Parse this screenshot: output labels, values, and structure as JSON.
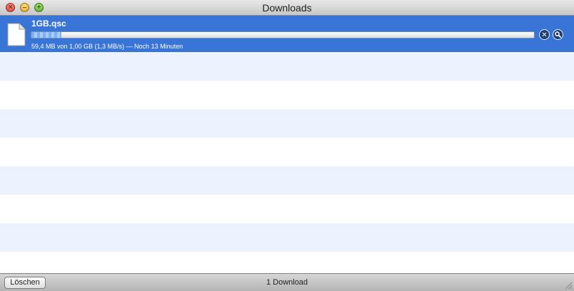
{
  "window": {
    "title": "Downloads",
    "controls": {
      "close_glyph": "×",
      "minimize_glyph": "–",
      "zoom_glyph": "+"
    }
  },
  "downloads": [
    {
      "filename": "1GB.qsc",
      "status": "59,4 MB von 1,00 GB (1,3 MB/s) — Noch 13 Minuten",
      "progress_fraction": 0.0594,
      "icon": "document-icon",
      "stop_glyph": "✕",
      "reveal_icon": "magnifier-icon"
    }
  ],
  "footer": {
    "clear_label": "Löschen",
    "count_text": "1 Download"
  },
  "colors": {
    "selection": "#3875d7",
    "stripe": "#edf3fe"
  }
}
